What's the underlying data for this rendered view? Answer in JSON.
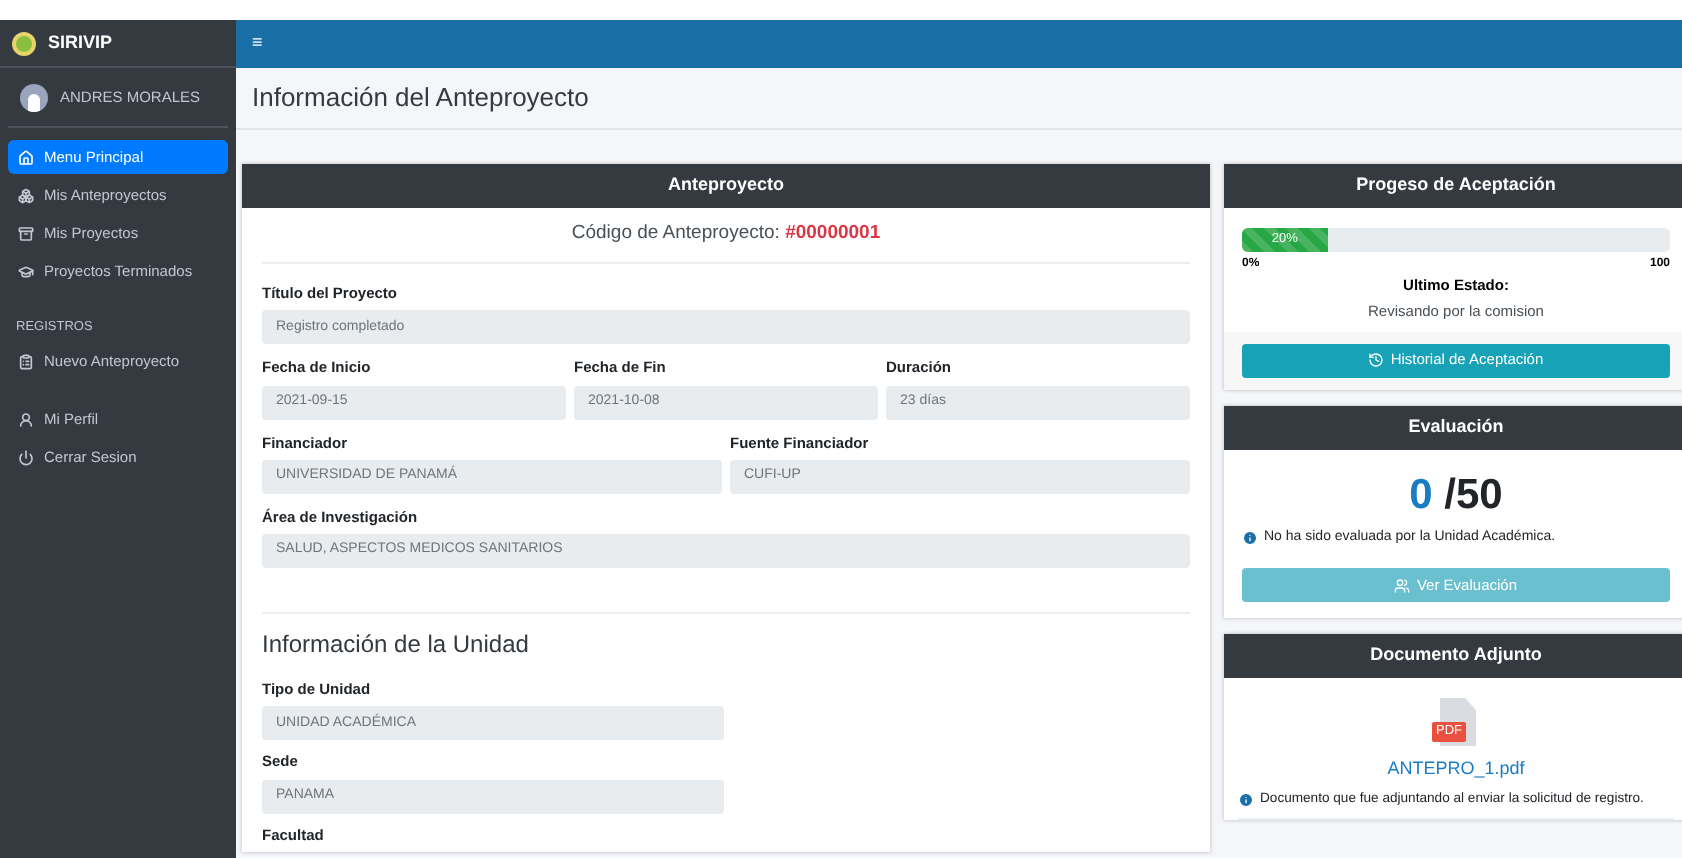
{
  "sidebar": {
    "brand": "SIRIVIP",
    "user": "ANDRES MORALES",
    "groups": [
      {
        "items": [
          {
            "label": "Menu Principal",
            "selected": true
          },
          {
            "label": "Mis Anteproyectos",
            "selected": false
          },
          {
            "label": "Mis Proyectos",
            "selected": false
          },
          {
            "label": "Proyectos Terminados",
            "selected": false
          }
        ]
      },
      {
        "header": "REGISTROS",
        "items": [
          {
            "label": "Nuevo Anteproyecto",
            "selected": false
          }
        ]
      },
      {
        "items": [
          {
            "label": "Mi Perfil",
            "selected": false
          },
          {
            "label": "Cerrar Sesion",
            "selected": false
          }
        ]
      }
    ]
  },
  "topbar": {
    "menu_glyph": "≡"
  },
  "page_title": "Información del Anteproyecto",
  "anteproyecto": {
    "header": "Anteproyecto",
    "code_label": "Código de Anteproyecto:",
    "code": "#00000001",
    "rows": [
      [
        {
          "label": "Título del Proyecto",
          "value": "Registro completado"
        }
      ],
      [
        {
          "label": "Fecha de Inicio",
          "value": "2021-09-15"
        },
        {
          "label": "Fecha de Fin",
          "value": "2021-10-08"
        },
        {
          "label": "Duración",
          "value": "23 días"
        }
      ],
      [
        {
          "label": "Financiador",
          "value": "UNIVERSIDAD DE PANAMÁ"
        },
        {
          "label": "Fuente Financiador",
          "value": "CUFI-UP"
        }
      ],
      [
        {
          "label": "Área de Investigación",
          "value": "SALUD, ASPECTOS MEDICOS SANITARIOS"
        }
      ]
    ],
    "unit_title": "Información de la Unidad",
    "unit_fields": [
      {
        "label": "Tipo de Unidad",
        "value": "UNIDAD ACADÉMICA"
      },
      {
        "label": "Sede",
        "value": "PANAMA"
      },
      {
        "label": "Facultad"
      }
    ]
  },
  "progreso": {
    "header": "Progeso de Aceptación",
    "level": 0.2,
    "bar_label": "20%",
    "min_label": "0%",
    "max_label": "100",
    "status_label": "Ultimo Estado:",
    "status": "Revisando por la comision",
    "button": {
      "label": "Historial de Aceptación",
      "disabled": false
    }
  },
  "evaluacion": {
    "header": "Evaluación",
    "score": "0",
    "total": "/50",
    "note": "No ha sido evaluada por la Unidad Académica.",
    "button": {
      "label": "Ver Evaluación",
      "disabled": true
    }
  },
  "documento": {
    "header": "Documento Adjunto",
    "badge": "PDF",
    "file": "ANTEPRO_1.pdf",
    "note": "Documento que fue adjuntando al enviar la solicitud de registro."
  }
}
